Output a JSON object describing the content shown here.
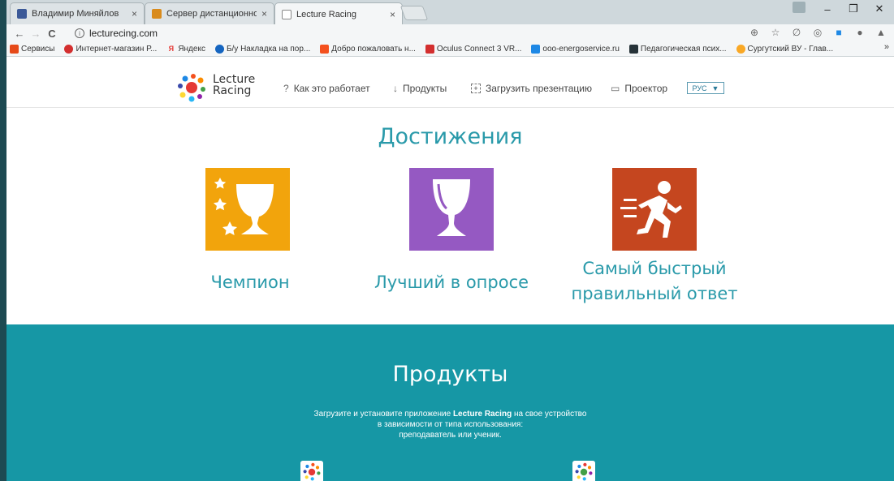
{
  "tabs": [
    {
      "title": "Владимир Миняйлов",
      "close": "×",
      "icon_color": "#3b5998"
    },
    {
      "title": "Сервер дистанционного",
      "close": "×",
      "icon_color": "#d98b1c"
    },
    {
      "title": "Lecture Racing",
      "close": "×",
      "icon_color": "#ffffff"
    }
  ],
  "window_controls": {
    "minimize": "–",
    "restore": "❐",
    "close": "✕"
  },
  "address_bar": {
    "back": "←",
    "forward": "→",
    "reload": "C",
    "info": "i",
    "url": "lecturecing.com"
  },
  "toolbar_icons": [
    "zoom-icon",
    "star-icon",
    "extension-icon",
    "extension-icon",
    "extension-icon",
    "extension-icon",
    "extension-icon"
  ],
  "bookmarks": [
    {
      "label": "Сервисы",
      "icon_color": "#e64a19"
    },
    {
      "label": "Интернет-магазин Р...",
      "icon_color": "#d32f2f"
    },
    {
      "label": "Яндекс",
      "icon_color": "#e53935",
      "glyph": "Я"
    },
    {
      "label": "Б/у Накладка на пор...",
      "icon_color": "#1565c0"
    },
    {
      "label": "Добро пожаловать н...",
      "icon_color": "#f4511e"
    },
    {
      "label": "Oculus Connect 3 VR...",
      "icon_color": "#d32f2f"
    },
    {
      "label": "ooo-energoservice.ru",
      "icon_color": "#1e88e5"
    },
    {
      "label": "Педагогическая псих...",
      "icon_color": "#263238"
    },
    {
      "label": "Сургутский ВУ - Глав...",
      "icon_color": "#f9a825"
    }
  ],
  "bookmarks_more": "»",
  "site": {
    "logo_line1": "Lecture",
    "logo_line2": "Racing",
    "nav": [
      {
        "icon": "?",
        "label": "Как это работает"
      },
      {
        "icon": "↓",
        "label": "Продукты"
      },
      {
        "icon": "+",
        "label": "Загрузить презентацию"
      },
      {
        "icon": "▭",
        "label": "Проектор"
      }
    ],
    "lang": {
      "value": "РУС",
      "arrow": "▼"
    }
  },
  "achievements": {
    "title": "Достижения",
    "items": [
      {
        "label": "Чемпион",
        "color": "#f2a40c",
        "icon": "trophy-stars-icon"
      },
      {
        "label": "Лучший в опросе",
        "color": "#9559c2",
        "icon": "trophy-icon"
      },
      {
        "label_line1": "Самый быстрый",
        "label_line2": "правильный ответ",
        "color": "#c5461f",
        "icon": "running-man-icon"
      }
    ]
  },
  "products": {
    "title": "Продукты",
    "desc_prefix": "Загрузите и установите приложение ",
    "desc_bold": "Lecture Racing",
    "desc_suffix": " на свое устройство",
    "desc_line2": "в зависимости от типа использования:",
    "desc_line3": "преподаватель или ученик.",
    "bg_color": "#1697a5"
  }
}
